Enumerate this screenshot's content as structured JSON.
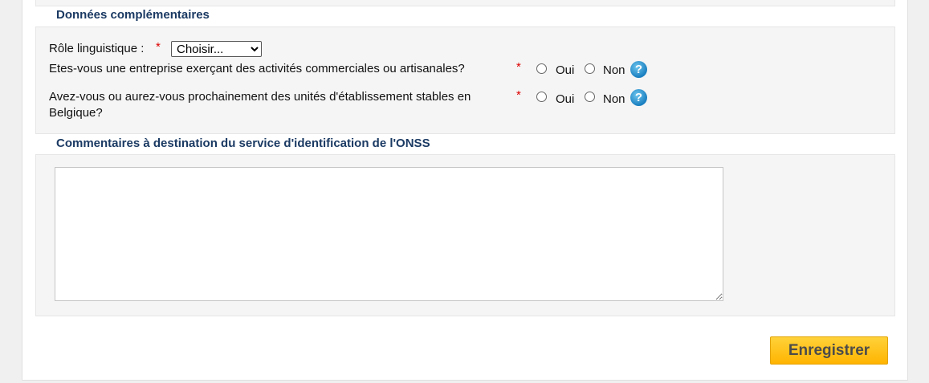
{
  "sections": {
    "complementary_title": "Données complémentaires",
    "comments_title": "Commentaires à destination du service d'identification de l'ONSS"
  },
  "form": {
    "language_role_label": "Rôle linguistique :",
    "required_mark": "*",
    "language_role_selected": "Choisir...",
    "q1_label": "Etes-vous une entreprise exerçant des activités commerciales ou artisanales?",
    "q2_label": "Avez-vous ou aurez-vous prochainement des unités d'établissement stables en Belgique?",
    "yes_label": "Oui",
    "no_label": "Non",
    "help_glyph": "?"
  },
  "comments": {
    "value": ""
  },
  "actions": {
    "save_label": "Enregistrer"
  },
  "icons": {
    "help": "help-icon",
    "select_arrow": "chevron-down-icon"
  },
  "colors": {
    "section_title": "#1b3a63",
    "required": "#dd0000",
    "button": "#ffc000"
  }
}
